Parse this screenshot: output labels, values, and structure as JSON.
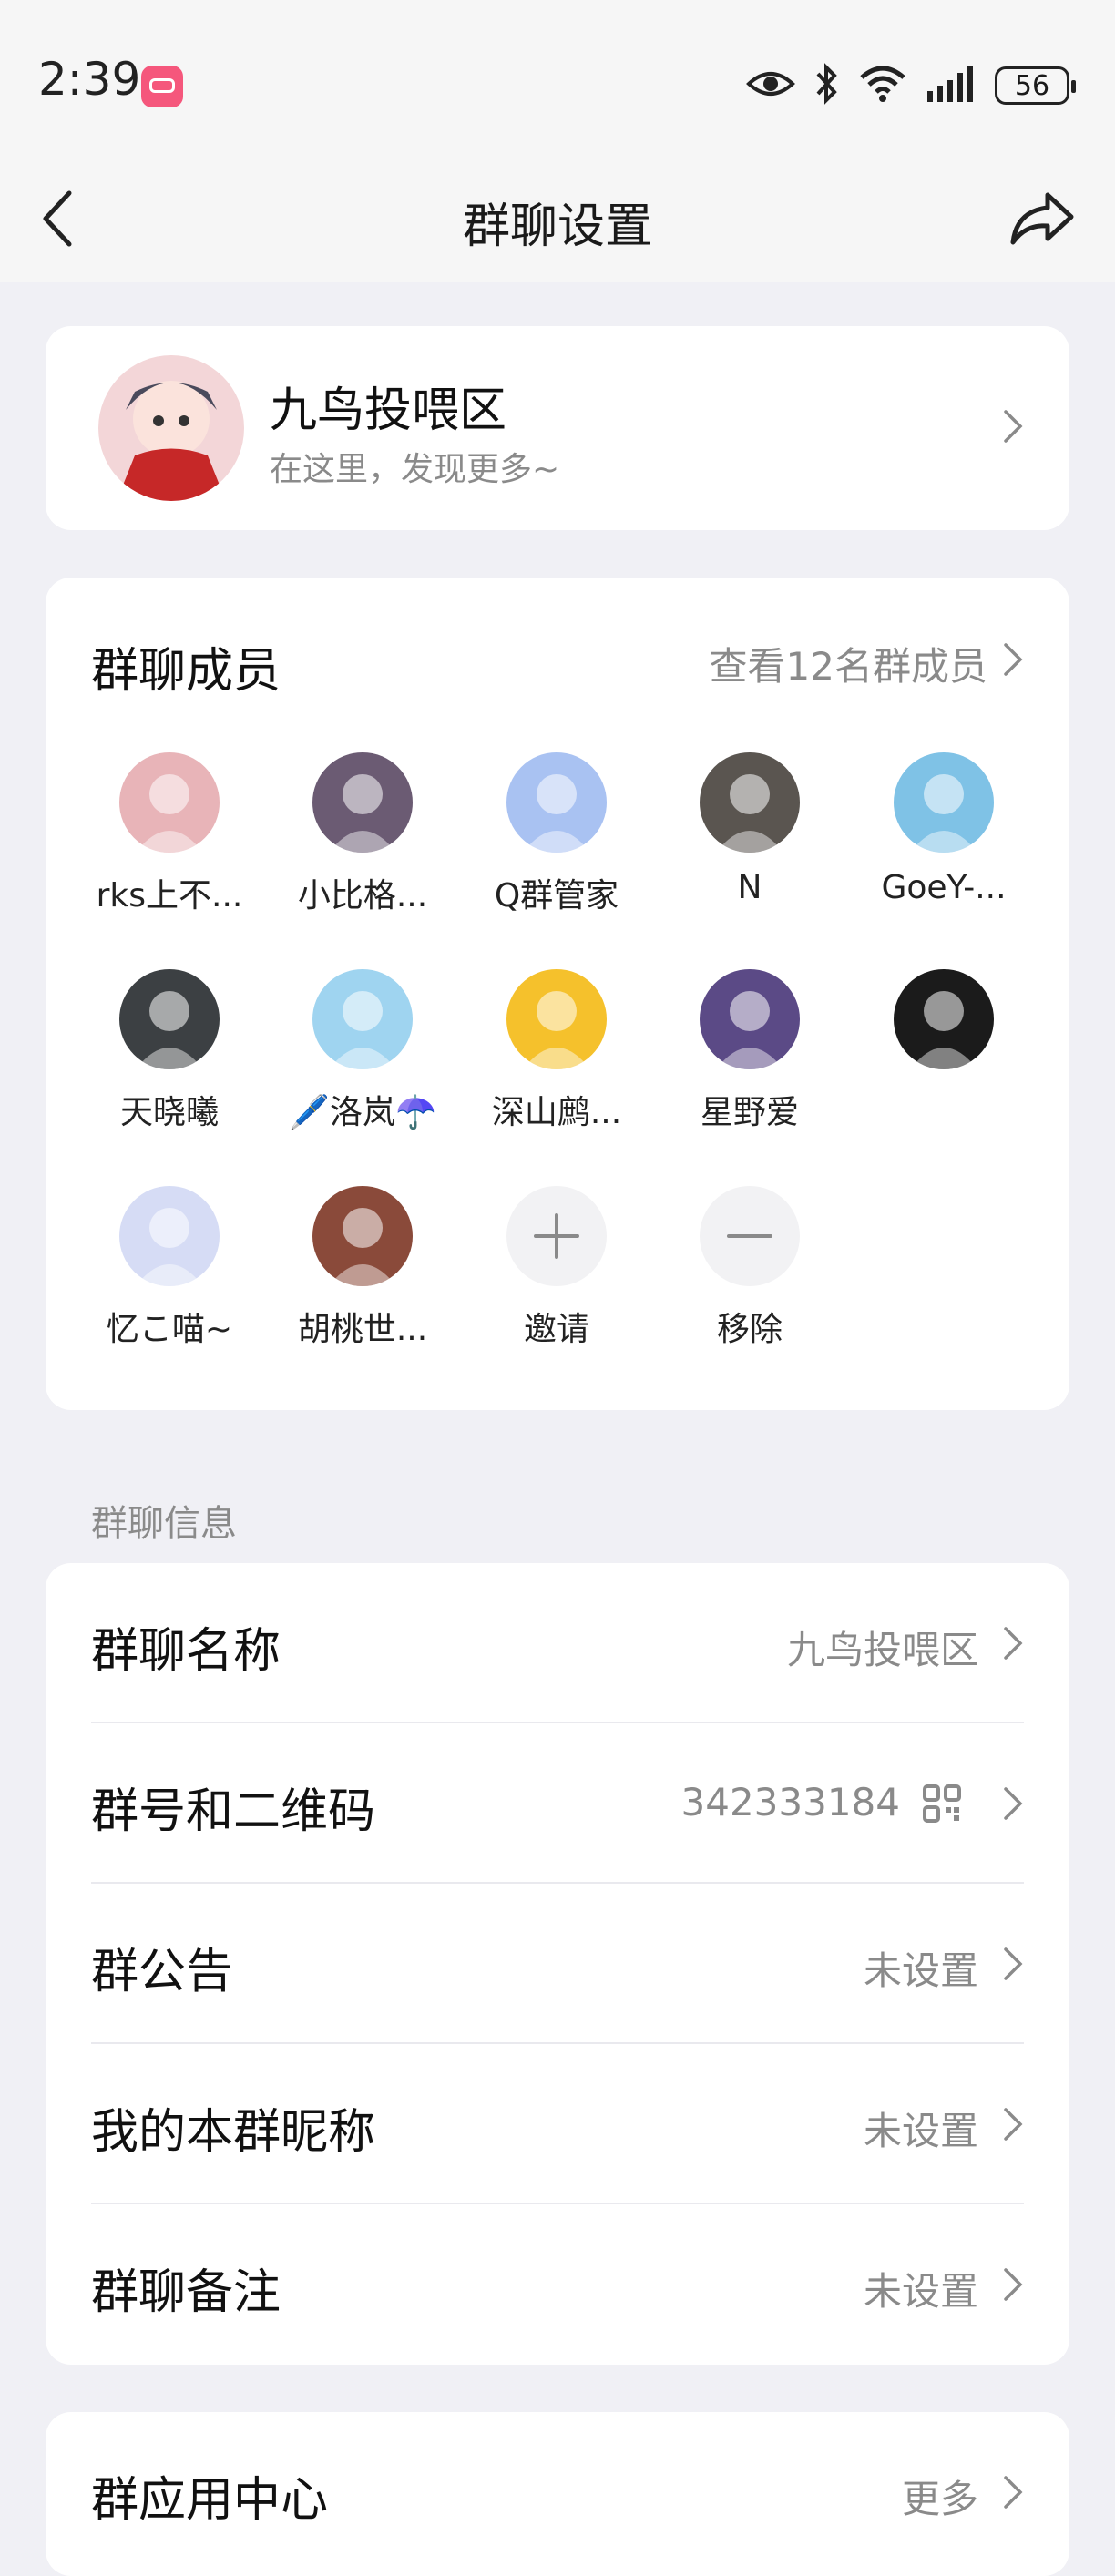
{
  "status_bar": {
    "time": "2:39",
    "battery": "56"
  },
  "nav": {
    "title": "群聊设置"
  },
  "group": {
    "name": "九鸟投喂区",
    "subtitle": "在这里，发现更多~"
  },
  "members": {
    "title": "群聊成员",
    "view_all": "查看12名群成员",
    "items": [
      {
        "name": "rks上不...",
        "color": "#e8b4b8"
      },
      {
        "name": "小比格...",
        "color": "#6b5b73"
      },
      {
        "name": "Q群管家",
        "color": "#a9c2f2"
      },
      {
        "name": "N",
        "color": "#5a5550"
      },
      {
        "name": "GoeY-...",
        "color": "#7fc2e6"
      },
      {
        "name": "天晓曦",
        "color": "#3c4043"
      },
      {
        "name": "🖊️洛岚☂️",
        "color": "#9fd4f0"
      },
      {
        "name": "深山鹧...",
        "color": "#f5c12c"
      },
      {
        "name": "星野爱",
        "color": "#5b4a86"
      },
      {
        "name": "",
        "color": "#1b1b1b"
      },
      {
        "name": "忆こ喵~",
        "color": "#d6dcf5"
      },
      {
        "name": "胡桃世...",
        "color": "#8a4a3a"
      },
      {
        "name": "邀请",
        "color": "#f2f2f4"
      },
      {
        "name": "移除",
        "color": "#f2f2f4"
      }
    ]
  },
  "section_info": "群聊信息",
  "info_rows": [
    {
      "label": "群聊名称",
      "value": "九鸟投喂区"
    },
    {
      "label": "群号和二维码",
      "value": "342333184"
    },
    {
      "label": "群公告",
      "value": "未设置"
    },
    {
      "label": "我的本群昵称",
      "value": "未设置"
    },
    {
      "label": "群聊备注",
      "value": "未设置"
    }
  ],
  "apps": {
    "label": "群应用中心",
    "value": "更多"
  }
}
